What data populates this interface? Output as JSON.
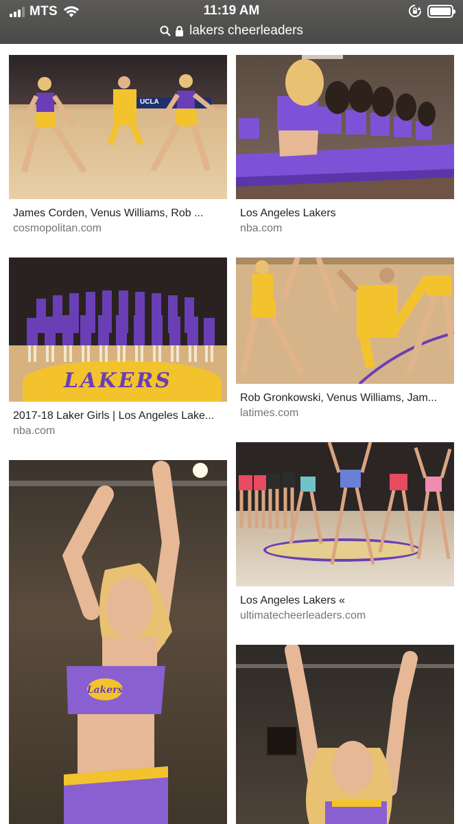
{
  "status": {
    "carrier": "MTS",
    "time": "11:19 AM"
  },
  "url": {
    "text": "lakers cheerleaders"
  },
  "colors": {
    "lakers_purple": "#6a3fb5",
    "lakers_gold": "#f3c32e",
    "court_wood": "#d9b98e"
  },
  "results": [
    {
      "title": "James Corden, Venus Williams, Rob ...",
      "source": "cosmopolitan.com"
    },
    {
      "title": "Los Angeles Lakers",
      "source": "nba.com"
    },
    {
      "title": "2017-18 Laker Girls | Los Angeles Lake...",
      "source": "nba.com"
    },
    {
      "title": "Rob Gronkowski, Venus Williams, Jam...",
      "source": "latimes.com"
    },
    {
      "title": "",
      "source": ""
    },
    {
      "title": "Los Angeles Lakers «",
      "source": "ultimatecheerleaders.com"
    },
    {
      "title": "",
      "source": ""
    }
  ],
  "image_text": {
    "court_logo": "LAKERS",
    "top_logo": "Lakers",
    "banner": "UCLA"
  }
}
